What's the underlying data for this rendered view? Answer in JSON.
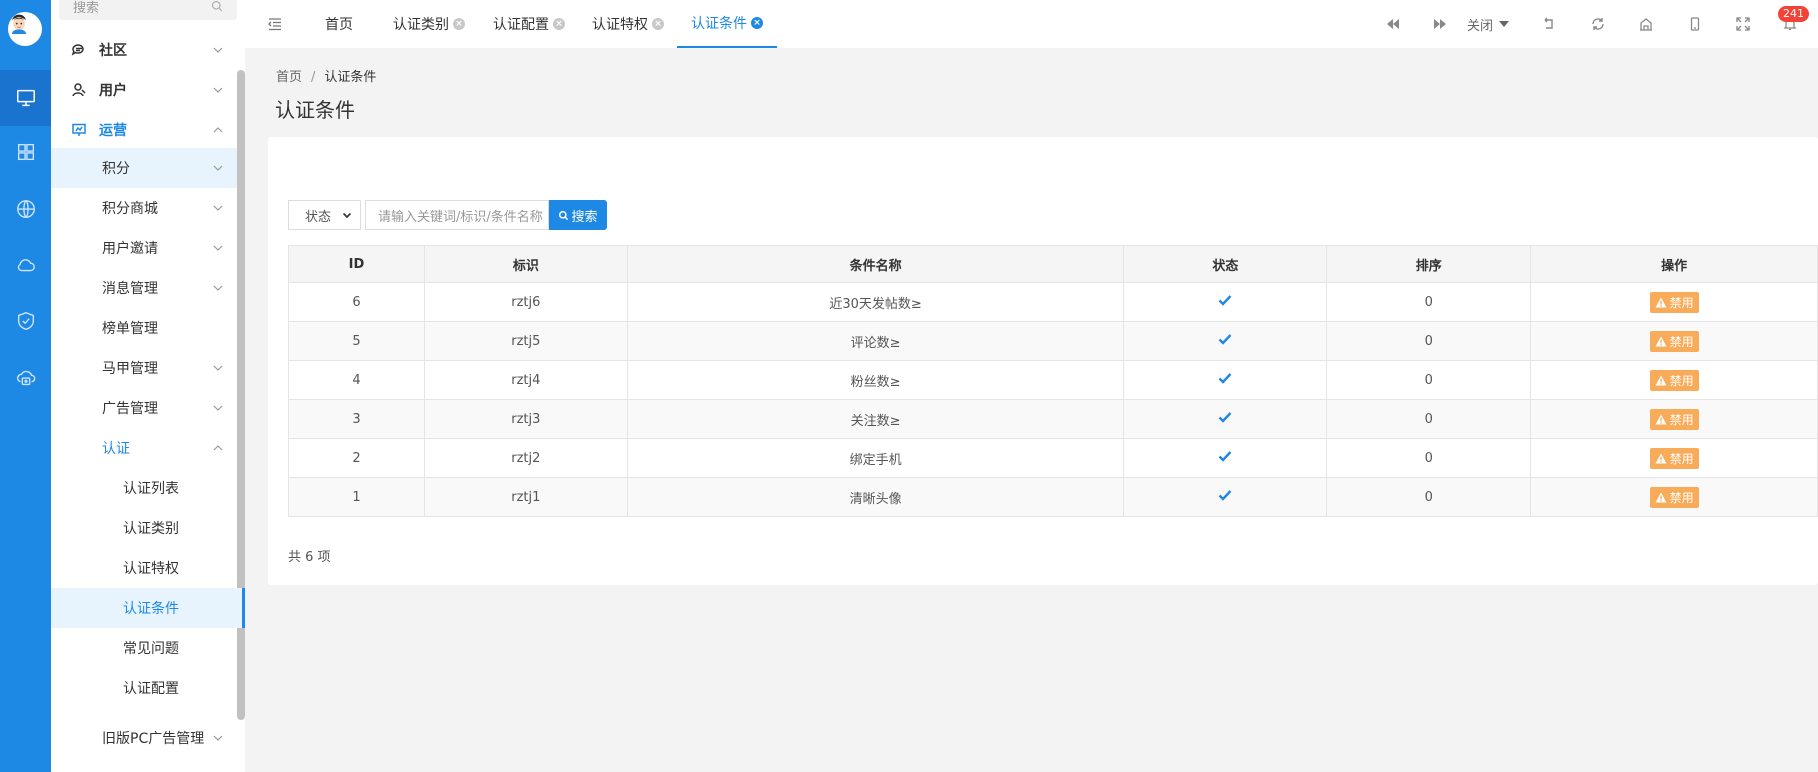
{
  "sidebar": {
    "search_placeholder": "搜索",
    "items": [
      {
        "label": "社区"
      },
      {
        "label": "用户"
      },
      {
        "label": "运营"
      },
      {
        "label": "积分"
      },
      {
        "label": "积分商城"
      },
      {
        "label": "用户邀请"
      },
      {
        "label": "消息管理"
      },
      {
        "label": "榜单管理"
      },
      {
        "label": "马甲管理"
      },
      {
        "label": "广告管理"
      },
      {
        "label": "认证"
      },
      {
        "label": "认证列表"
      },
      {
        "label": "认证类别"
      },
      {
        "label": "认证特权"
      },
      {
        "label": "认证条件"
      },
      {
        "label": "常见问题"
      },
      {
        "label": "认证配置"
      },
      {
        "label": "旧版PC广告管理"
      }
    ]
  },
  "tabs": [
    {
      "label": "首页"
    },
    {
      "label": "认证类别"
    },
    {
      "label": "认证配置"
    },
    {
      "label": "认证特权"
    },
    {
      "label": "认证条件"
    }
  ],
  "toolbar": {
    "close_label": "关闭",
    "notification_count": "241"
  },
  "breadcrumb": {
    "home": "首页",
    "sep": "/",
    "current": "认证条件"
  },
  "page": {
    "title": "认证条件"
  },
  "filter": {
    "status_label": "状态",
    "search_placeholder": "请输入关键词/标识/条件名称",
    "search_button": "搜索"
  },
  "table": {
    "headers": [
      "ID",
      "标识",
      "条件名称",
      "状态",
      "排序",
      "操作"
    ],
    "rows": [
      {
        "id": "6",
        "key": "rztj6",
        "name": "近30天发帖数≥",
        "sort": "0",
        "action": "禁用"
      },
      {
        "id": "5",
        "key": "rztj5",
        "name": "评论数≥",
        "sort": "0",
        "action": "禁用"
      },
      {
        "id": "4",
        "key": "rztj4",
        "name": "粉丝数≥",
        "sort": "0",
        "action": "禁用"
      },
      {
        "id": "3",
        "key": "rztj3",
        "name": "关注数≥",
        "sort": "0",
        "action": "禁用"
      },
      {
        "id": "2",
        "key": "rztj2",
        "name": "绑定手机",
        "sort": "0",
        "action": "禁用"
      },
      {
        "id": "1",
        "key": "rztj1",
        "name": "清晰头像",
        "sort": "0",
        "action": "禁用"
      }
    ]
  },
  "footer": {
    "total": "共 6 项"
  },
  "colors": {
    "primary": "#1e88e5",
    "warning": "#f8ac59",
    "danger": "#f44336"
  }
}
